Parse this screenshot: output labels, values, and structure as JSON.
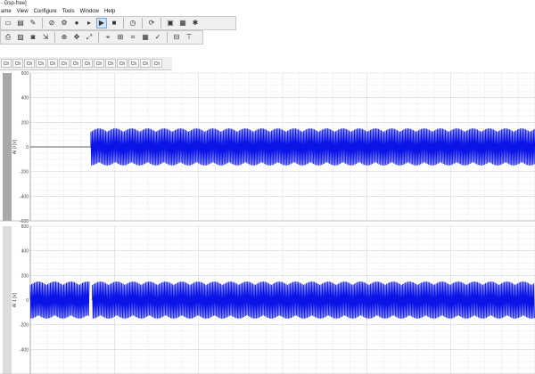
{
  "window": {
    "title": "- Gsp-free]"
  },
  "menu": [
    "ame",
    "View",
    "Configure",
    "Tools",
    "Window",
    "Help"
  ],
  "toolbar1": [
    {
      "icon": "save-icon",
      "glyph": "▭"
    },
    {
      "icon": "open-folder-icon",
      "glyph": "▤"
    },
    {
      "icon": "edit-icon",
      "glyph": "✎"
    },
    {
      "sep": true
    },
    {
      "icon": "stop-sign-icon",
      "glyph": "⊘"
    },
    {
      "icon": "settings-icon",
      "glyph": "⚙"
    },
    {
      "icon": "record-icon",
      "glyph": "●"
    },
    {
      "icon": "step-icon",
      "glyph": "▸"
    },
    {
      "icon": "play-icon",
      "glyph": "▶",
      "active": true
    },
    {
      "icon": "stop-icon",
      "glyph": "■"
    },
    {
      "sep": true
    },
    {
      "icon": "timer-icon",
      "glyph": "◷"
    },
    {
      "sep": true
    },
    {
      "icon": "refresh-icon",
      "glyph": "⟳"
    },
    {
      "sep": true
    },
    {
      "icon": "monitor-icon",
      "glyph": "▣"
    },
    {
      "icon": "chip-icon",
      "glyph": "▦"
    },
    {
      "icon": "tools-icon",
      "glyph": "✱"
    }
  ],
  "toolbar2": [
    {
      "icon": "print-icon",
      "glyph": "⎙"
    },
    {
      "icon": "image-icon",
      "glyph": "▨"
    },
    {
      "icon": "camera-icon",
      "glyph": "◙"
    },
    {
      "icon": "export-icon",
      "glyph": "⇲"
    },
    {
      "sep": true
    },
    {
      "icon": "zoom-icon",
      "glyph": "⊕"
    },
    {
      "icon": "pan-icon",
      "glyph": "✥"
    },
    {
      "icon": "zoom-fit-icon",
      "glyph": "⤢"
    },
    {
      "sep": true
    },
    {
      "icon": "cursor-icon",
      "glyph": "⌖"
    },
    {
      "icon": "measure-icon",
      "glyph": "⊞"
    },
    {
      "icon": "marker-icon",
      "glyph": "⌗"
    },
    {
      "icon": "table-icon",
      "glyph": "▦"
    },
    {
      "icon": "check-icon",
      "glyph": "✓"
    },
    {
      "sep": true
    },
    {
      "icon": "split-horizontal-icon",
      "glyph": "⊟"
    },
    {
      "icon": "split-vertical-icon",
      "glyph": "⊤"
    }
  ],
  "channel_tabs": [
    "Ch",
    "Ch",
    "Ch",
    "Ch",
    "Ch",
    "Ch",
    "Ch",
    "Ch",
    "Ch",
    "Ch",
    "Ch",
    "Ch",
    "Ch",
    "Ch"
  ],
  "chart_data": [
    {
      "type": "line",
      "channel_label": "AI 0 [V]",
      "ylim": [
        -600,
        600
      ],
      "yticks": [
        600,
        400,
        200,
        0,
        -200,
        -400,
        -600
      ],
      "grid": true,
      "signal": {
        "color": "#0a14e6",
        "segments": [
          {
            "from": 0,
            "to": 0.12,
            "amplitude": 0
          },
          {
            "from": 0.12,
            "to": 1.0,
            "amplitude": 150
          }
        ]
      }
    },
    {
      "type": "line",
      "channel_label": "AI 1 [V]",
      "ylim": [
        -600,
        600
      ],
      "yticks": [
        600,
        400,
        200,
        0,
        -200,
        -400
      ],
      "grid": true,
      "signal": {
        "color": "#0a14e6",
        "segments": [
          {
            "from": 0,
            "to": 0.117,
            "amplitude": 150
          },
          {
            "from": 0.123,
            "to": 1.0,
            "amplitude": 150
          }
        ]
      }
    }
  ]
}
